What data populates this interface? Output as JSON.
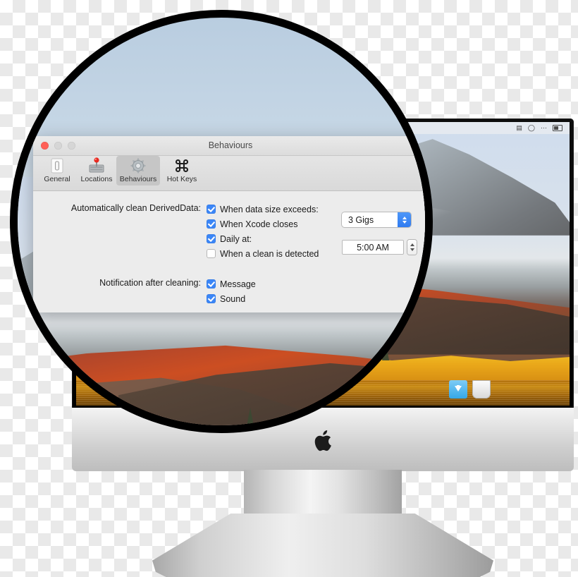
{
  "device": {
    "brand_logo": "apple-logo",
    "type": "imac-desktop-computer"
  },
  "desktop": {
    "wallpaper_name": "macos-high-sierra-mountain-lake",
    "menubar": {
      "icons": [
        "finder-status-icon",
        "clock-icon",
        "ellipsis-icon",
        "battery-icon"
      ]
    },
    "dock": {
      "items": [
        "downloads-folder",
        "trash"
      ]
    }
  },
  "window": {
    "title": "Behaviours",
    "traffic_lights": {
      "close": "close",
      "minimize": "minimize",
      "zoom": "zoom"
    },
    "toolbar": {
      "items": [
        {
          "label": "General",
          "icon": "toggle-switch-icon",
          "selected": false
        },
        {
          "label": "Locations",
          "icon": "hard-drive-pin-icon",
          "selected": false
        },
        {
          "label": "Behaviours",
          "icon": "gear-icon",
          "selected": true
        },
        {
          "label": "Hot Keys",
          "icon": "command-key-icon",
          "selected": false
        }
      ]
    },
    "sections": [
      {
        "label": "Automatically clean DerivedData:",
        "checkboxes": [
          {
            "label": "When data size exceeds:",
            "checked": true
          },
          {
            "label": "When Xcode closes",
            "checked": true
          },
          {
            "label": "Daily at:",
            "checked": true
          },
          {
            "label": "When a clean is detected",
            "checked": false
          }
        ],
        "size_popup": {
          "value": "3 Gigs"
        },
        "time_field": {
          "value": "5:00 AM"
        }
      },
      {
        "label": "Notification after cleaning:",
        "checkboxes": [
          {
            "label": "Message",
            "checked": true
          },
          {
            "label": "Sound",
            "checked": true
          }
        ]
      }
    ]
  },
  "colors": {
    "accent_blue": "#3b86f7",
    "close_red": "#ff5f57",
    "window_bg": "#ececec",
    "toolbar_selected": "#c6c6c6"
  }
}
